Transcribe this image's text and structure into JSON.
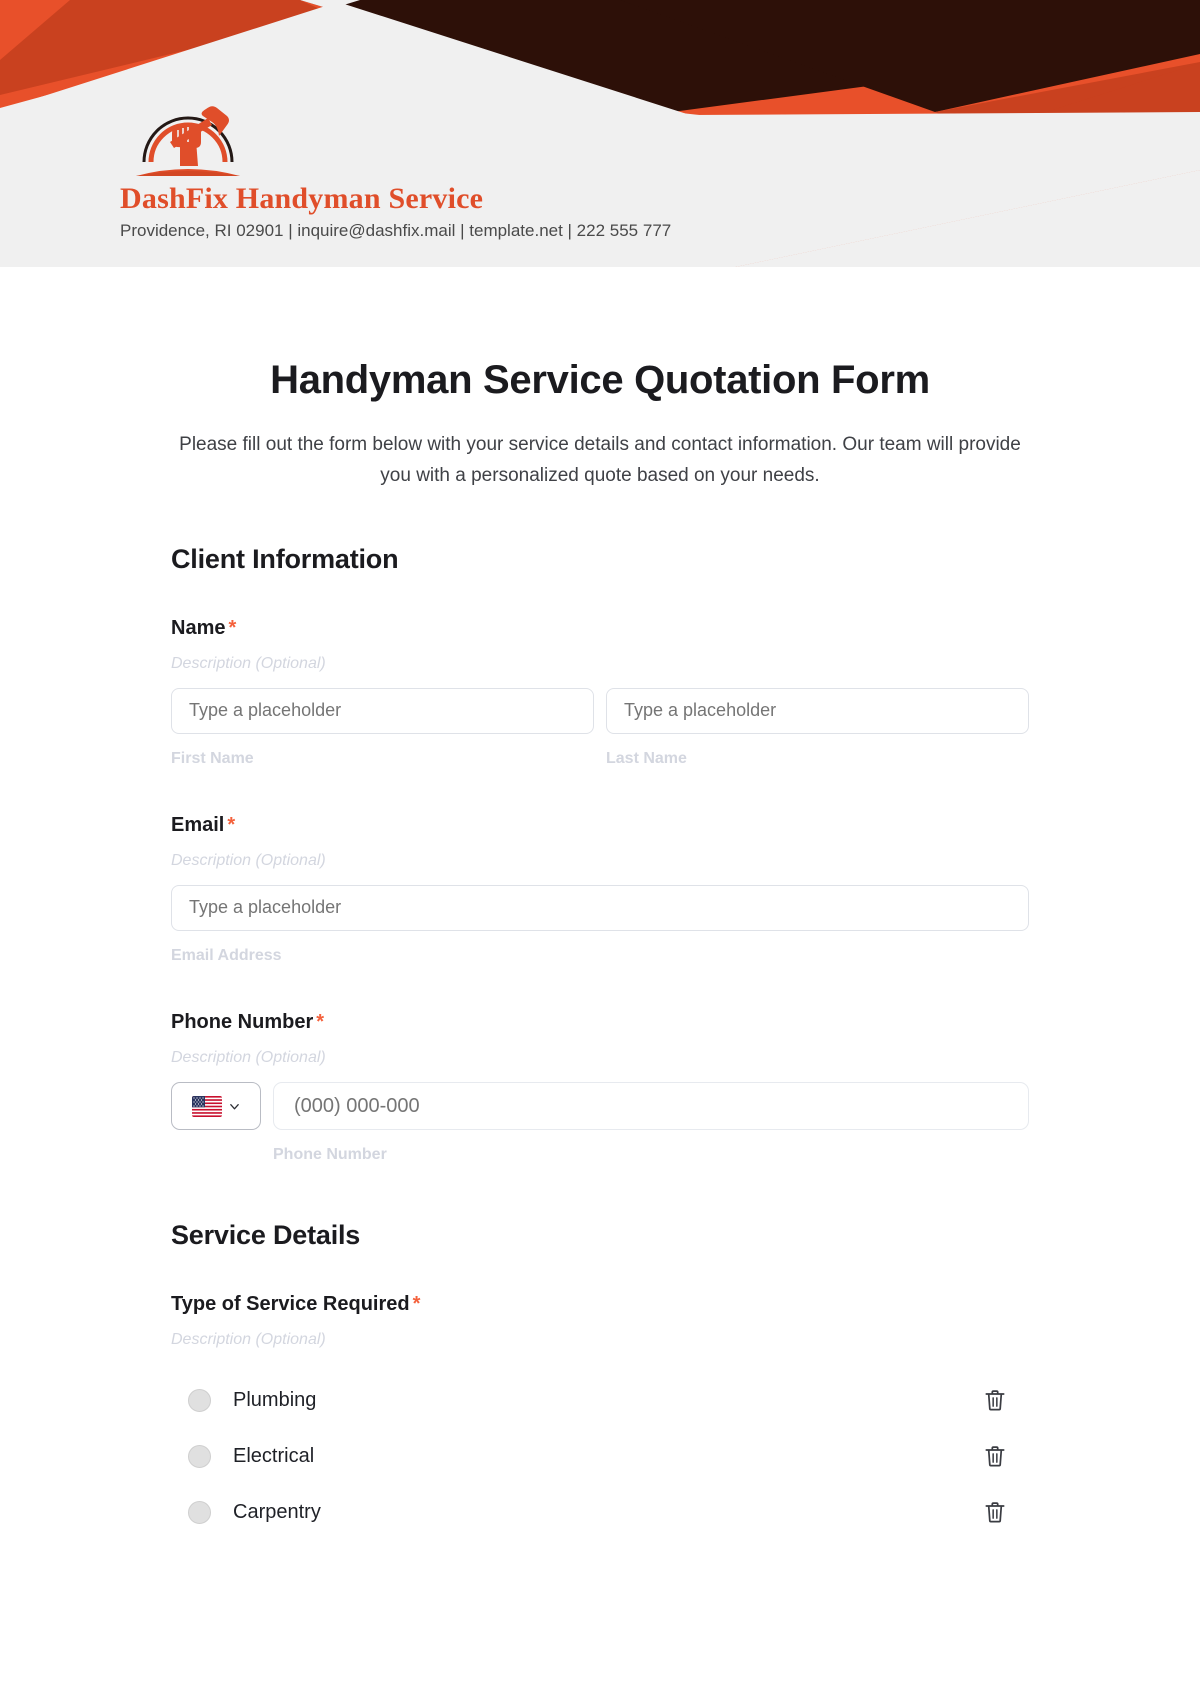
{
  "letterhead": {
    "brand_name": "DashFix Handyman Service",
    "contact_line": "Providence, RI 02901 | inquire@dashfix.mail | template.net | 222 555 777",
    "logo_icon": "fist-hammer-icon",
    "colors": {
      "accent_orange": "#e04e2a",
      "bright_orange": "#e8502a",
      "dark_orange": "#c9411f",
      "dark_brown": "#2d1008",
      "panel_gray": "#f0f0f0"
    }
  },
  "form": {
    "title": "Handyman Service Quotation Form",
    "subtitle": "Please fill out the form below with your service details and contact information. Our team will provide you with a personalized quote based on your needs.",
    "sections": [
      {
        "heading": "Client Information",
        "fields": [
          {
            "label": "Name",
            "required_marker": "*",
            "description": "Description (Optional)",
            "inputs": [
              {
                "placeholder": "Type a placeholder",
                "sub_label": "First Name"
              },
              {
                "placeholder": "Type a placeholder",
                "sub_label": "Last Name"
              }
            ]
          },
          {
            "label": "Email",
            "required_marker": "*",
            "description": "Description (Optional)",
            "inputs": [
              {
                "placeholder": "Type a placeholder",
                "sub_label": "Email Address"
              }
            ]
          },
          {
            "label": "Phone Number",
            "required_marker": "*",
            "description": "Description (Optional)",
            "country_flag": "us-flag-icon",
            "dropdown_icon": "chevron-down-icon",
            "phone_placeholder": "(000) 000-000",
            "sub_label": "Phone Number"
          }
        ]
      },
      {
        "heading": "Service Details",
        "fields": [
          {
            "label": "Type of Service Required",
            "required_marker": "*",
            "description": "Description (Optional)",
            "options": [
              {
                "label": "Plumbing",
                "delete_icon": "trash-icon"
              },
              {
                "label": "Electrical",
                "delete_icon": "trash-icon"
              },
              {
                "label": "Carpentry",
                "delete_icon": "trash-icon"
              }
            ]
          }
        ]
      }
    ]
  }
}
